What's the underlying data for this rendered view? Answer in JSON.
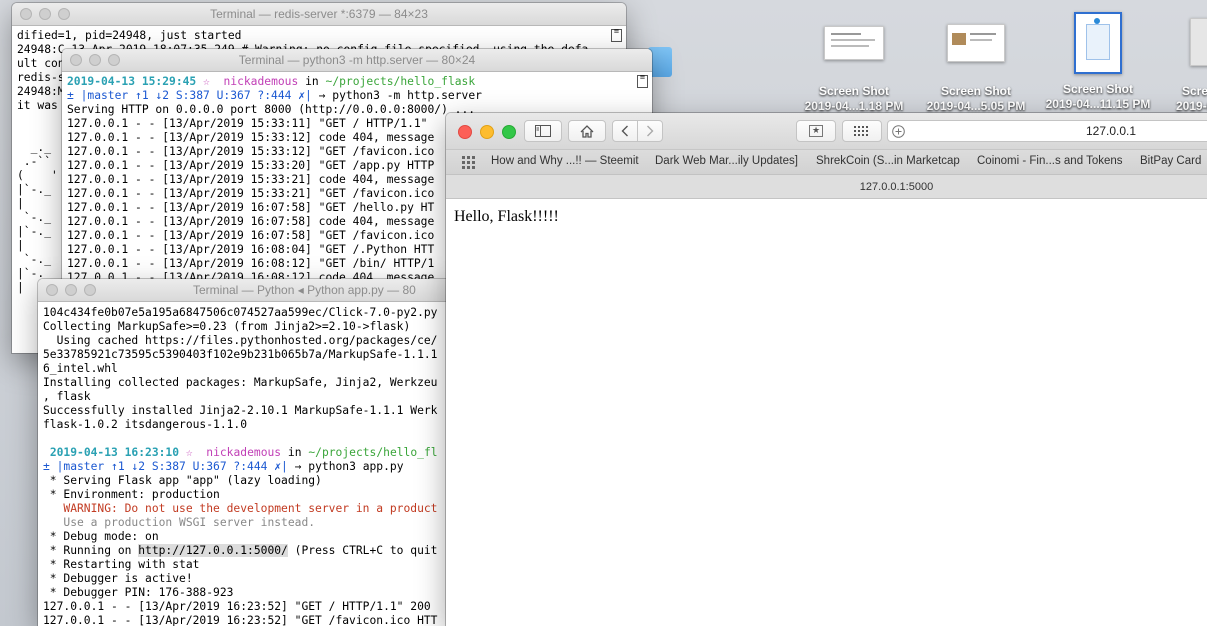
{
  "desktop": {
    "icons": [
      {
        "name": "Screen Shot",
        "date": "2019-04...1.18 PM"
      },
      {
        "name": "Screen Shot",
        "date": "2019-04...5.05 PM"
      },
      {
        "name": "Screen Shot",
        "date": "2019-04...11.15 PM"
      },
      {
        "name": "Scre",
        "date": "2019-0"
      }
    ]
  },
  "redis_window": {
    "title": "Terminal — redis-server *:6379 — 84×23",
    "lines": [
      "dified=1, pid=24948, just started",
      "24948:C 13 Apr 2019 18:07:35.249 # Warning: no config file specified, using the defa",
      "ult config. In order to specify a config file use redis-server /path/to/redis.conf",
      "redis-s",
      "24948:M",
      "it was",
      "",
      "",
      "  _._",
      " .-``",
      "(    '",
      "|`-._",
      "|    ",
      " `-._",
      "|`-._",
      "|    ",
      " `-._",
      "|`-._",
      "|"
    ]
  },
  "http_window": {
    "title": "Terminal — python3 -m http.server — 80×24",
    "prompt_date": "2019-04-13 15:29:45",
    "prompt_star": "☆",
    "user": "nickademous",
    "prompt_in": "in",
    "path": "~/projects/hello_flask",
    "git": "± |master ↑1 ↓2 S:387 U:367 ?:444 ✗|",
    "arrow": "→",
    "command": "python3 -m http.server",
    "output": [
      "Serving HTTP on 0.0.0.0 port 8000 (http://0.0.0.0:8000/) ...",
      "127.0.0.1 - - [13/Apr/2019 15:33:11] \"GET / HTTP/1.1\"",
      "127.0.0.1 - - [13/Apr/2019 15:33:12] code 404, message",
      "127.0.0.1 - - [13/Apr/2019 15:33:12] \"GET /favicon.ico",
      "127.0.0.1 - - [13/Apr/2019 15:33:20] \"GET /app.py HTTP",
      "127.0.0.1 - - [13/Apr/2019 15:33:21] code 404, message",
      "127.0.0.1 - - [13/Apr/2019 15:33:21] \"GET /favicon.ico",
      "127.0.0.1 - - [13/Apr/2019 16:07:58] \"GET /hello.py HT",
      "127.0.0.1 - - [13/Apr/2019 16:07:58] code 404, message",
      "127.0.0.1 - - [13/Apr/2019 16:07:58] \"GET /favicon.ico",
      "127.0.0.1 - - [13/Apr/2019 16:08:04] \"GET /.Python HTT",
      "127.0.0.1 - - [13/Apr/2019 16:08:12] \"GET /bin/ HTTP/1",
      "127.0.0.1 - - [13/Apr/2019 16:08:12] code 404, message"
    ]
  },
  "flask_window": {
    "title": "Terminal — Python ◂ Python app.py — 80",
    "install_lines": [
      "104c434fe0b07e5a195a6847506c074527aa599ec/Click-7.0-py2.py",
      "Collecting MarkupSafe>=0.23 (from Jinja2>=2.10->flask)",
      "  Using cached https://files.pythonhosted.org/packages/ce/",
      "5e33785921c73595c5390403f102e9b231b065b7a/MarkupSafe-1.1.1",
      "6_intel.whl",
      "Installing collected packages: MarkupSafe, Jinja2, Werkzeu",
      ", flask",
      "Successfully installed Jinja2-2.10.1 MarkupSafe-1.1.1 Werk",
      "flask-1.0.2 itsdangerous-1.1.0",
      ""
    ],
    "prompt_date": "2019-04-13 16:23:10",
    "prompt_star": "☆",
    "user": "nickademous",
    "prompt_in": "in",
    "path": "~/projects/hello_fl",
    "git": "± |master ↑1 ↓2 S:387 U:367 ?:444 ✗|",
    "arrow": "→",
    "command": "python3 app.py",
    "serving": " * Serving Flask app \"app\" (lazy loading)",
    "environment": " * Environment: production",
    "warning1": "   WARNING: Do not use the development server in a product",
    "warning2": "   Use a production WSGI server instead.",
    "debug_mode": " * Debug mode: on",
    "running_prefix": " * Running on ",
    "running_url": "http://127.0.0.1:5000/",
    "running_suffix": " (Press CTRL+C to quit",
    "restarting": " * Restarting with stat",
    "debugger_active": " * Debugger is active!",
    "debugger_pin": " * Debugger PIN: 176-388-923",
    "log1": "127.0.0.1 - - [13/Apr/2019 16:23:52] \"GET / HTTP/1.1\" 200",
    "log2": "127.0.0.1 - - [13/Apr/2019 16:23:52] \"GET /favicon.ico HTT"
  },
  "safari": {
    "address": "127.0.0.1",
    "tab_title": "127.0.0.1:5000",
    "favorites": [
      "How and Why ...!! — Steemit",
      "Dark Web Mar...ily Updates]",
      "ShrekCoin (S...in Marketcap",
      "Coinomi - Fin...s and Tokens",
      "BitPay Card"
    ],
    "page_text": "Hello, Flask!!!!!"
  },
  "colors": {
    "close": "#fc5f57",
    "minimize": "#fdbc2e",
    "zoom": "#33c748",
    "prompt_date": "#2aa1b3",
    "prompt_user": "#c13fb6",
    "prompt_path": "#3aa53a",
    "warning": "#c23b22"
  }
}
